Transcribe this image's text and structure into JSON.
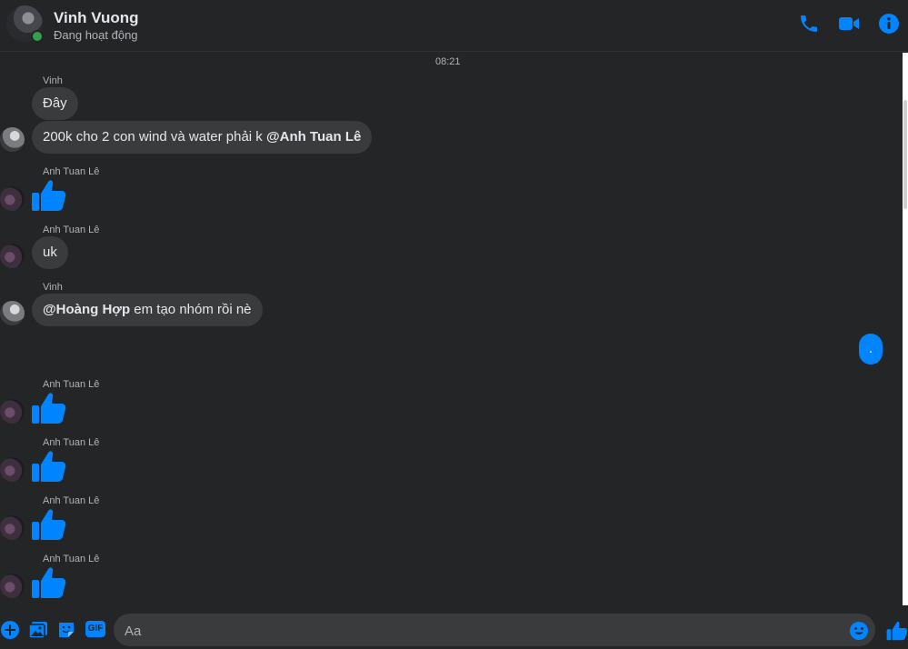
{
  "header": {
    "name": "Vinh Vuong",
    "status": "Đang hoạt động"
  },
  "timestamp": "08:21",
  "messages": [
    {
      "sender": "Vinh",
      "text": "Đây"
    },
    {
      "text_plain": "200k cho 2 con wind và water phải k ",
      "mention": "@Anh Tuan Lê"
    },
    {
      "sender": "Anh Tuan Lê",
      "type": "like"
    },
    {
      "sender": "Anh Tuan Lê",
      "text": "uk"
    },
    {
      "sender": "Vinh",
      "mention": "@Hoàng Hợp",
      "text_plain": " em tạo nhóm rồi nè"
    },
    {
      "mine": true,
      "text": "."
    },
    {
      "sender": "Anh Tuan Lê",
      "type": "like"
    },
    {
      "sender": "Anh Tuan Lê",
      "type": "like"
    },
    {
      "sender": "Anh Tuan Lê",
      "type": "like"
    },
    {
      "sender": "Anh Tuan Lê",
      "type": "like"
    }
  ],
  "composer": {
    "placeholder": "Aa",
    "gif_label": "GIF"
  },
  "colors": {
    "accent": "#0084ff",
    "background": "#242526",
    "bubble": "#3a3b3c",
    "online": "#31a24c"
  },
  "icons": [
    "phone-icon",
    "video-icon",
    "info-icon",
    "plus-icon",
    "image-icon",
    "sticker-icon",
    "gif-icon",
    "emoji-icon",
    "like-icon"
  ]
}
